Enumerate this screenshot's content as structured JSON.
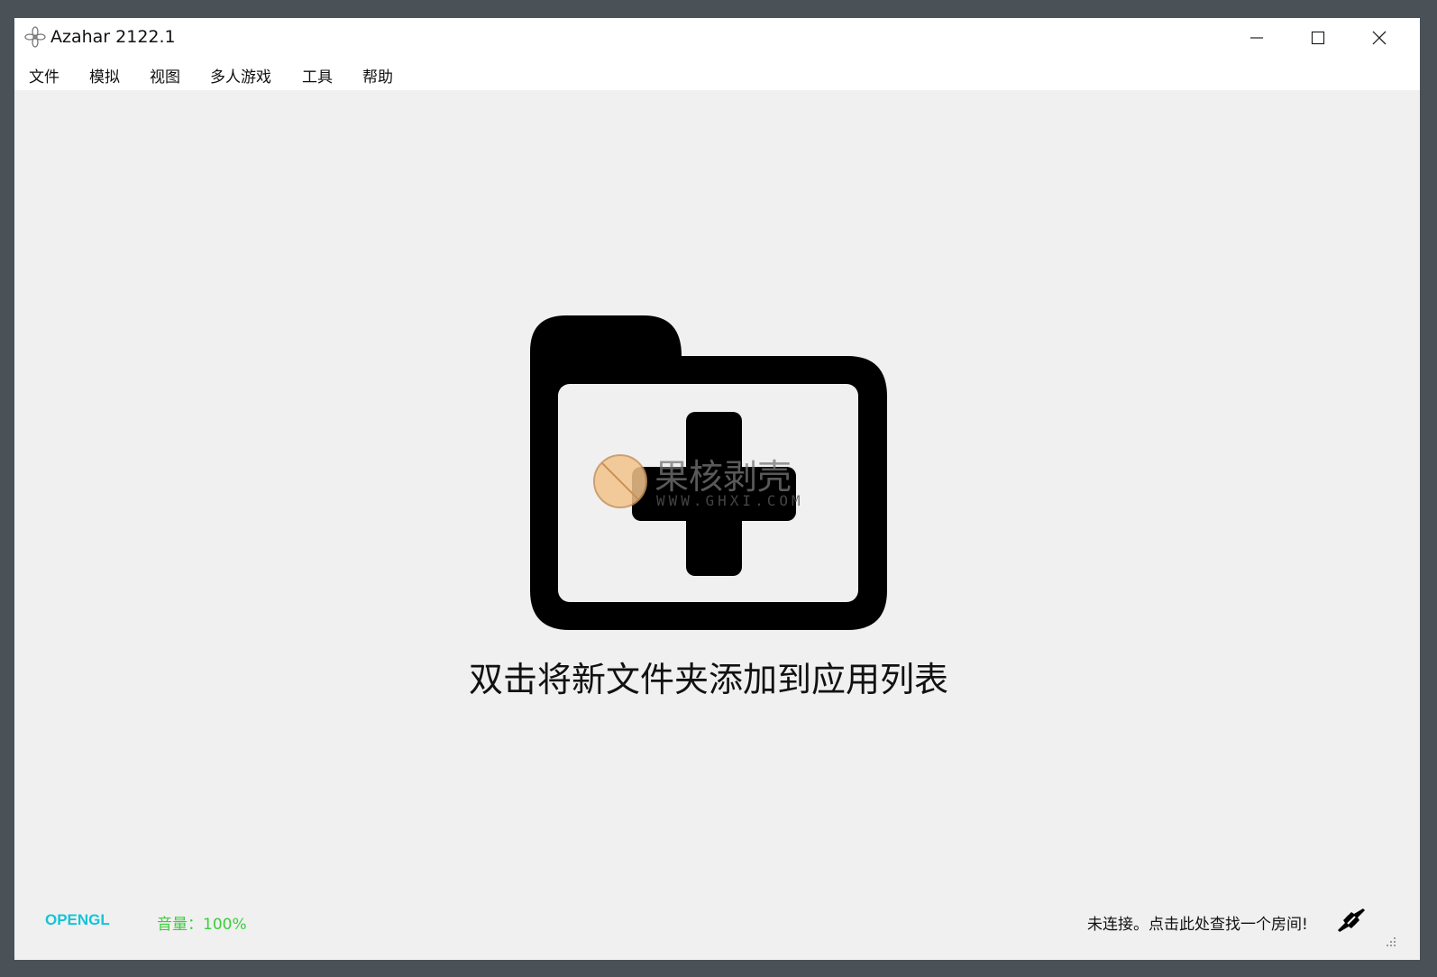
{
  "window": {
    "title": "Azahar 2122.1"
  },
  "menu": {
    "items": [
      {
        "label": "文件"
      },
      {
        "label": "模拟"
      },
      {
        "label": "视图"
      },
      {
        "label": "多人游戏"
      },
      {
        "label": "工具"
      },
      {
        "label": "帮助"
      }
    ]
  },
  "main": {
    "hint": "双击将新文件夹添加到应用列表",
    "icon": "folder-add-icon"
  },
  "watermark": {
    "name": "果核剥壳",
    "url": "WWW.GHXI.COM"
  },
  "status": {
    "renderer": "OPENGL",
    "volume": "音量：100%",
    "room": "未连接。点击此处查找一个房间!",
    "icons": [
      "network-disconnected-icon",
      "resize-grip-icon"
    ]
  },
  "colors": {
    "renderer": "#15c4d8",
    "volume": "#3ccd3c",
    "background": "#f0f0f0",
    "frame": "#4b5257"
  }
}
